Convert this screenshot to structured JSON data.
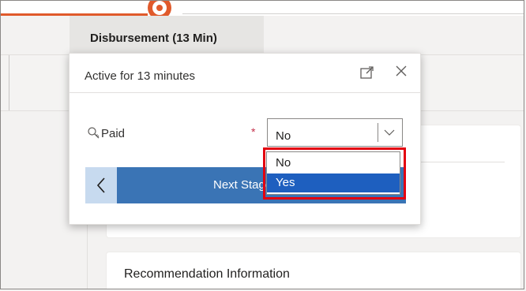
{
  "stage": {
    "title": "Disbursement  (13 Min)"
  },
  "flyout": {
    "status_text": "Active for 13 minutes",
    "field": {
      "label": "Paid",
      "required_mark": "*",
      "selected_value": "No"
    },
    "next_label": "Next Stage",
    "dropdown_options": [
      "No",
      "Yes"
    ],
    "highlighted_option": "Yes"
  },
  "sections": {
    "recommendation_title": "Recommendation Information"
  },
  "colors": {
    "progress_accent": "#e05a2b",
    "primary_button": "#3a74b5",
    "selected_option": "#1e5fbf",
    "annotation_box": "#e3000f"
  }
}
